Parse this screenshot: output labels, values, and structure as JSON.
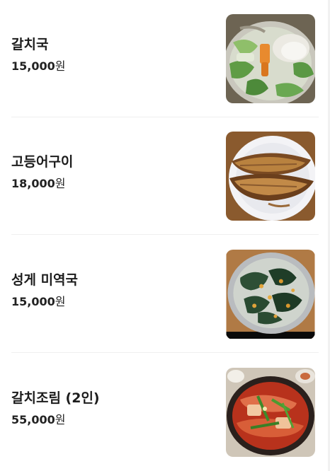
{
  "menu": {
    "items": [
      {
        "name": "갈치국",
        "price_number": "15,000",
        "price_unit": "원",
        "image_icon": "fish-soup-photo-icon"
      },
      {
        "name": "고등어구이",
        "price_number": "18,000",
        "price_unit": "원",
        "image_icon": "grilled-mackerel-photo-icon"
      },
      {
        "name": "성게 미역국",
        "price_number": "15,000",
        "price_unit": "원",
        "image_icon": "seaweed-soup-photo-icon"
      },
      {
        "name": "갈치조림 (2인)",
        "price_number": "55,000",
        "price_unit": "원",
        "image_icon": "braised-cutlassfish-photo-icon"
      }
    ]
  }
}
